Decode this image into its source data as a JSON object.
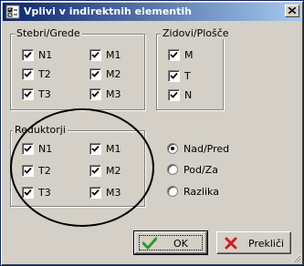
{
  "window": {
    "title": "Vplivi v indirektnih elementih"
  },
  "groups": {
    "stebri": {
      "title": "Stebri/Grede",
      "items": [
        {
          "label": "N1",
          "checked": true
        },
        {
          "label": "M1",
          "checked": true
        },
        {
          "label": "T2",
          "checked": true
        },
        {
          "label": "M2",
          "checked": true
        },
        {
          "label": "T3",
          "checked": true
        },
        {
          "label": "M3",
          "checked": true
        }
      ]
    },
    "zidovi": {
      "title": "Zidovi/Plošče",
      "items": [
        {
          "label": "M",
          "checked": true
        },
        {
          "label": "T",
          "checked": true
        },
        {
          "label": "N",
          "checked": true
        }
      ]
    },
    "reduktorji": {
      "title": "Reduktorji",
      "items": [
        {
          "label": "N1",
          "checked": true
        },
        {
          "label": "M1",
          "checked": true
        },
        {
          "label": "T2",
          "checked": true
        },
        {
          "label": "M2",
          "checked": true
        },
        {
          "label": "T3",
          "checked": true
        },
        {
          "label": "M3",
          "checked": true
        }
      ]
    }
  },
  "radios": [
    {
      "label": "Nad/Pred",
      "selected": true
    },
    {
      "label": "Pod/Za",
      "selected": false
    },
    {
      "label": "Razlika",
      "selected": false
    }
  ],
  "buttons": {
    "ok": "OK",
    "cancel": "Prekliči"
  },
  "colors": {
    "titlebar_start": "#0a246a",
    "titlebar_end": "#a6caf0",
    "ok_check": "#2a9a2a",
    "cancel_x": "#d02020"
  }
}
